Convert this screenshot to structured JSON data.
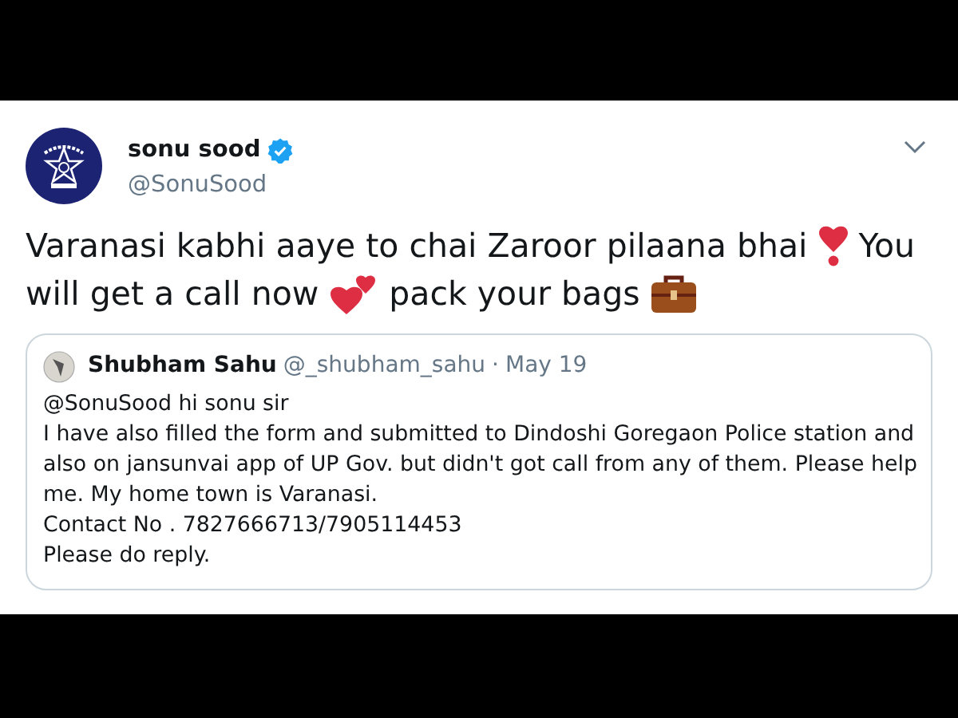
{
  "tweet": {
    "name": "sonu sood",
    "verified": true,
    "handle": "@SonuSood",
    "text_lines": [
      [
        {
          "kind": "text",
          "text": "Varanasi kabhi aaye to chai Zaroor pilaana bhai"
        },
        {
          "kind": "exclamation"
        },
        {
          "kind": "text",
          "text": "You"
        }
      ],
      [
        {
          "kind": "text",
          "text": "will get a call now"
        },
        {
          "kind": "hearts"
        },
        {
          "kind": "text",
          "text": "pack your bags"
        },
        {
          "kind": "briefcase"
        }
      ]
    ],
    "quote": {
      "name": "Shubham Sahu",
      "handle": "@_shubham_sahu",
      "separator": "·",
      "date": "May 19",
      "lines": [
        "@SonuSood hi sonu sir",
        "I have also filled the form and submitted to Dindoshi Goregaon Police station and",
        "also on jansunvai app of UP Gov. but didn't got call from any of them. Please help",
        "me. My home town is Varanasi.",
        "Contact No . 7827666713/7905114453",
        "Please do reply."
      ]
    }
  }
}
